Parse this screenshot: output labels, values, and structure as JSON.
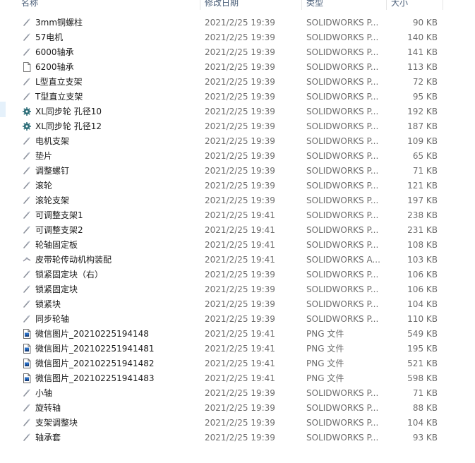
{
  "columns": {
    "name": "名称",
    "date": "修改日期",
    "type": "类型",
    "size": "大小"
  },
  "files": [
    {
      "name": "3mm铜螺柱",
      "date": "2021/2/25 19:39",
      "type": "SOLIDWORKS P...",
      "size": "90 KB",
      "icon": "solidworks-part-icon"
    },
    {
      "name": "57电机",
      "date": "2021/2/25 19:39",
      "type": "SOLIDWORKS P...",
      "size": "140 KB",
      "icon": "solidworks-part-icon"
    },
    {
      "name": "6000轴承",
      "date": "2021/2/25 19:39",
      "type": "SOLIDWORKS P...",
      "size": "141 KB",
      "icon": "solidworks-part-icon"
    },
    {
      "name": "6200轴承",
      "date": "2021/2/25 19:39",
      "type": "SOLIDWORKS P...",
      "size": "113 KB",
      "icon": "blank-file-icon"
    },
    {
      "name": "L型直立支架",
      "date": "2021/2/25 19:39",
      "type": "SOLIDWORKS P...",
      "size": "72 KB",
      "icon": "solidworks-part-icon"
    },
    {
      "name": "T型直立支架",
      "date": "2021/2/25 19:39",
      "type": "SOLIDWORKS P...",
      "size": "95 KB",
      "icon": "solidworks-part-icon"
    },
    {
      "name": "XL同步轮 孔径10",
      "date": "2021/2/25 19:39",
      "type": "SOLIDWORKS P...",
      "size": "192 KB",
      "icon": "gear-part-icon"
    },
    {
      "name": "XL同步轮 孔径12",
      "date": "2021/2/25 19:39",
      "type": "SOLIDWORKS P...",
      "size": "187 KB",
      "icon": "gear-part-icon"
    },
    {
      "name": "电机支架",
      "date": "2021/2/25 19:39",
      "type": "SOLIDWORKS P...",
      "size": "109 KB",
      "icon": "solidworks-part-icon"
    },
    {
      "name": "垫片",
      "date": "2021/2/25 19:39",
      "type": "SOLIDWORKS P...",
      "size": "65 KB",
      "icon": "solidworks-part-icon"
    },
    {
      "name": "调整螺钉",
      "date": "2021/2/25 19:39",
      "type": "SOLIDWORKS P...",
      "size": "71 KB",
      "icon": "solidworks-part-icon"
    },
    {
      "name": "滚轮",
      "date": "2021/2/25 19:39",
      "type": "SOLIDWORKS P...",
      "size": "121 KB",
      "icon": "solidworks-part-icon"
    },
    {
      "name": "滚轮支架",
      "date": "2021/2/25 19:39",
      "type": "SOLIDWORKS P...",
      "size": "197 KB",
      "icon": "solidworks-part-icon"
    },
    {
      "name": "可调整支架1",
      "date": "2021/2/25 19:41",
      "type": "SOLIDWORKS P...",
      "size": "238 KB",
      "icon": "solidworks-part-icon"
    },
    {
      "name": "可调整支架2",
      "date": "2021/2/25 19:41",
      "type": "SOLIDWORKS P...",
      "size": "231 KB",
      "icon": "solidworks-part-icon"
    },
    {
      "name": "轮轴固定板",
      "date": "2021/2/25 19:41",
      "type": "SOLIDWORKS P...",
      "size": "108 KB",
      "icon": "solidworks-part-icon"
    },
    {
      "name": "皮带轮传动机构装配",
      "date": "2021/2/25 19:41",
      "type": "SOLIDWORKS A...",
      "size": "103 KB",
      "icon": "solidworks-assembly-icon"
    },
    {
      "name": "锁紧固定块（右）",
      "date": "2021/2/25 19:39",
      "type": "SOLIDWORKS P...",
      "size": "106 KB",
      "icon": "solidworks-part-icon"
    },
    {
      "name": "锁紧固定块",
      "date": "2021/2/25 19:39",
      "type": "SOLIDWORKS P...",
      "size": "106 KB",
      "icon": "solidworks-part-icon"
    },
    {
      "name": "锁紧块",
      "date": "2021/2/25 19:39",
      "type": "SOLIDWORKS P...",
      "size": "104 KB",
      "icon": "solidworks-part-icon"
    },
    {
      "name": "同步轮轴",
      "date": "2021/2/25 19:39",
      "type": "SOLIDWORKS P...",
      "size": "110 KB",
      "icon": "solidworks-part-icon"
    },
    {
      "name": "微信图片_20210225194148",
      "date": "2021/2/25 19:41",
      "type": "PNG 文件",
      "size": "549 KB",
      "icon": "png-image-icon"
    },
    {
      "name": "微信图片_202102251941481",
      "date": "2021/2/25 19:41",
      "type": "PNG 文件",
      "size": "195 KB",
      "icon": "png-image-icon"
    },
    {
      "name": "微信图片_202102251941482",
      "date": "2021/2/25 19:41",
      "type": "PNG 文件",
      "size": "521 KB",
      "icon": "png-image-icon"
    },
    {
      "name": "微信图片_202102251941483",
      "date": "2021/2/25 19:41",
      "type": "PNG 文件",
      "size": "598 KB",
      "icon": "png-image-icon"
    },
    {
      "name": "小轴",
      "date": "2021/2/25 19:39",
      "type": "SOLIDWORKS P...",
      "size": "71 KB",
      "icon": "solidworks-part-icon"
    },
    {
      "name": "旋转轴",
      "date": "2021/2/25 19:39",
      "type": "SOLIDWORKS P...",
      "size": "88 KB",
      "icon": "solidworks-part-icon"
    },
    {
      "name": "支架调整块",
      "date": "2021/2/25 19:39",
      "type": "SOLIDWORKS P...",
      "size": "104 KB",
      "icon": "solidworks-part-icon"
    },
    {
      "name": "轴承套",
      "date": "2021/2/25 19:39",
      "type": "SOLIDWORKS P...",
      "size": "93 KB",
      "icon": "solidworks-part-icon"
    }
  ]
}
